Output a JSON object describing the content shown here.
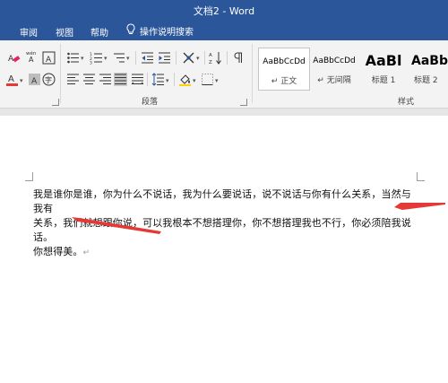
{
  "window": {
    "title": "文档2  -  Word"
  },
  "menu": {
    "tabs": [
      "审阅",
      "视图",
      "帮助"
    ],
    "tell_me": "操作说明搜索"
  },
  "ribbon": {
    "groups": {
      "paragraph": "段落",
      "styles": "样式"
    },
    "font_icons": [
      "eraser-format-icon",
      "phonetic-guide-icon",
      "character-border-icon",
      "font-color-icon",
      "character-shading-icon",
      "enclosed-character-icon"
    ],
    "paragraph_icons": [
      "bullets-icon",
      "numbering-icon",
      "multilevel-list-icon",
      "decrease-indent-icon",
      "increase-indent-icon",
      "chinese-layout-icon",
      "sort-icon",
      "show-marks-icon",
      "align-left-icon",
      "align-center-icon",
      "align-right-icon",
      "justify-icon",
      "distributed-icon",
      "line-spacing-icon",
      "shading-icon",
      "borders-icon"
    ],
    "font_icon_labels": {
      "phonetic": "wén",
      "enclosed": "字"
    },
    "styles": [
      {
        "sample": "AaBbCcDd",
        "name": "↵ 正文",
        "selected": true
      },
      {
        "sample": "AaBbCcDd",
        "name": "↵ 无间隔",
        "selected": false
      },
      {
        "sample": "AaBl",
        "name": "标题 1",
        "selected": false
      },
      {
        "sample": "AaBb(",
        "name": "标题 2",
        "selected": false
      }
    ]
  },
  "document": {
    "line1": "我是谁你是谁，你为什么不说话，我为什么要说话，说不说话与你有什么关系，当然与我有",
    "line2": "关系，我们就想跟你说，可以我根本不想搭理你，你不想搭理我也不行，你必须陪我说话。",
    "line3": "你想得美。",
    "para_mark": "↵"
  },
  "colors": {
    "title_bar": "#2b579a",
    "font_color_red": "#e53935",
    "annotation_arrow": "#e53935",
    "highlight_yellow": "#ffd200"
  }
}
